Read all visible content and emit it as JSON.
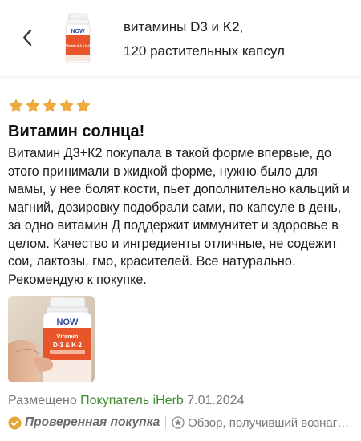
{
  "header": {
    "product_title_line1": "витамины D3 и K2,",
    "product_title_line2": "120 растительных капсул",
    "thumbnail_brand": "NOW",
    "thumbnail_label": "Vitamin D-3 & K-2"
  },
  "review": {
    "rating": 5,
    "rating_max": 5,
    "title": "Витамин солнца!",
    "body": "Витамин Д3+К2 покупала в такой форме впервые, до этого принимали в жидкой форме, нужно было для мамы, у нее болят кости, пьет дополнительно кальций и магний, дозировку подобрали сами, по капсуле в день, за одно витамин Д поддержит иммунитет и здоровье в целом. Качество и ингредиенты отличные, не содежит сои, лактозы, гмо, красителей. Все натурально. Рекомендую к покупке.",
    "photo_brand": "NOW",
    "photo_label_line1": "Vitamin",
    "photo_label_line2": "D-3 & K-2"
  },
  "meta": {
    "posted_prefix": "Размещено",
    "buyer": "Покупатель iHerb",
    "date": "7.01.2024",
    "verified_label": "Проверенная покупка",
    "disclaimer": "Обзор, получивший вознаграждение"
  },
  "colors": {
    "star": "#F2A93B",
    "buyer_link": "#3D8B2E",
    "verified_badge": "#E8A23A",
    "muted_text": "#777777",
    "bottle_orange": "#E8552A"
  },
  "icons": [
    "back-chevron-icon",
    "star-icon",
    "verified-check-icon",
    "reward-info-icon"
  ]
}
